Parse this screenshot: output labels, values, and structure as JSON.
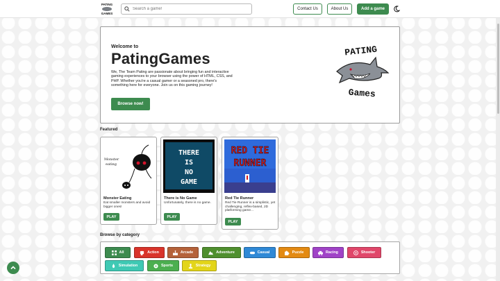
{
  "nav": {
    "logo_text_top": "PATING",
    "logo_text_bottom": "GAMES",
    "search_placeholder": "Search a game!",
    "contact_label": "Contact Us",
    "about_label": "About Us",
    "add_label": "Add a game"
  },
  "hero": {
    "welcome": "Welcome to",
    "title": "PatingGames",
    "description": "We, The Team Pating are passionate about bringing fun and interactive gaming experiences to your browser using the power of HTML, CSS, and PHP. Whether you're a casual gamer or a seasoned pro, there's something here for everyone. Join us on this gaming journey!",
    "button_label": "Browse now!",
    "logo_top": "PATING",
    "logo_bottom": "Games"
  },
  "featured": {
    "heading": "Featured",
    "games": [
      {
        "title": "Monster Eating",
        "description": "Eat smaller monsters and avoid bigger ones!",
        "play_label": "PLAY",
        "thumb_caption_1": "Monster",
        "thumb_caption_2": "eating"
      },
      {
        "title": "There is No Game",
        "description": "Unfortunately, there is no game.",
        "play_label": "PLAY",
        "thumb_words": [
          "THERE",
          "IS",
          "NO",
          "GAME"
        ]
      },
      {
        "title": "Red Tie Runner",
        "description": "Red Tie Runner is a simplistic, yet challenging, reflex-based, 2D platforming game...",
        "play_label": "PLAY",
        "thumb_words": [
          "RED TIE",
          "RUNNER"
        ]
      }
    ]
  },
  "categories": {
    "heading": "Browse by category",
    "items": [
      {
        "label": "All",
        "color": "#3d8b4f",
        "icon": "grid-icon"
      },
      {
        "label": "Action",
        "color": "#d9342b",
        "icon": "fist-icon"
      },
      {
        "label": "Arcade",
        "color": "#b5623a",
        "icon": "arcade-icon"
      },
      {
        "label": "Adventure",
        "color": "#4f8f2e",
        "icon": "map-icon"
      },
      {
        "label": "Casual",
        "color": "#2f89d6",
        "icon": "controller-icon"
      },
      {
        "label": "Puzzle",
        "color": "#e38a12",
        "icon": "puzzle-icon"
      },
      {
        "label": "Racing",
        "color": "#a043c7",
        "icon": "car-icon"
      },
      {
        "label": "Shooter",
        "color": "#e0476a",
        "icon": "target-icon"
      },
      {
        "label": "Simulation",
        "color": "#3fc9b4",
        "icon": "rocket-icon"
      },
      {
        "label": "Sports",
        "color": "#4caf50",
        "icon": "ball-icon"
      },
      {
        "label": "Strategy",
        "color": "#e3d51a",
        "icon": "chess-icon"
      }
    ]
  }
}
